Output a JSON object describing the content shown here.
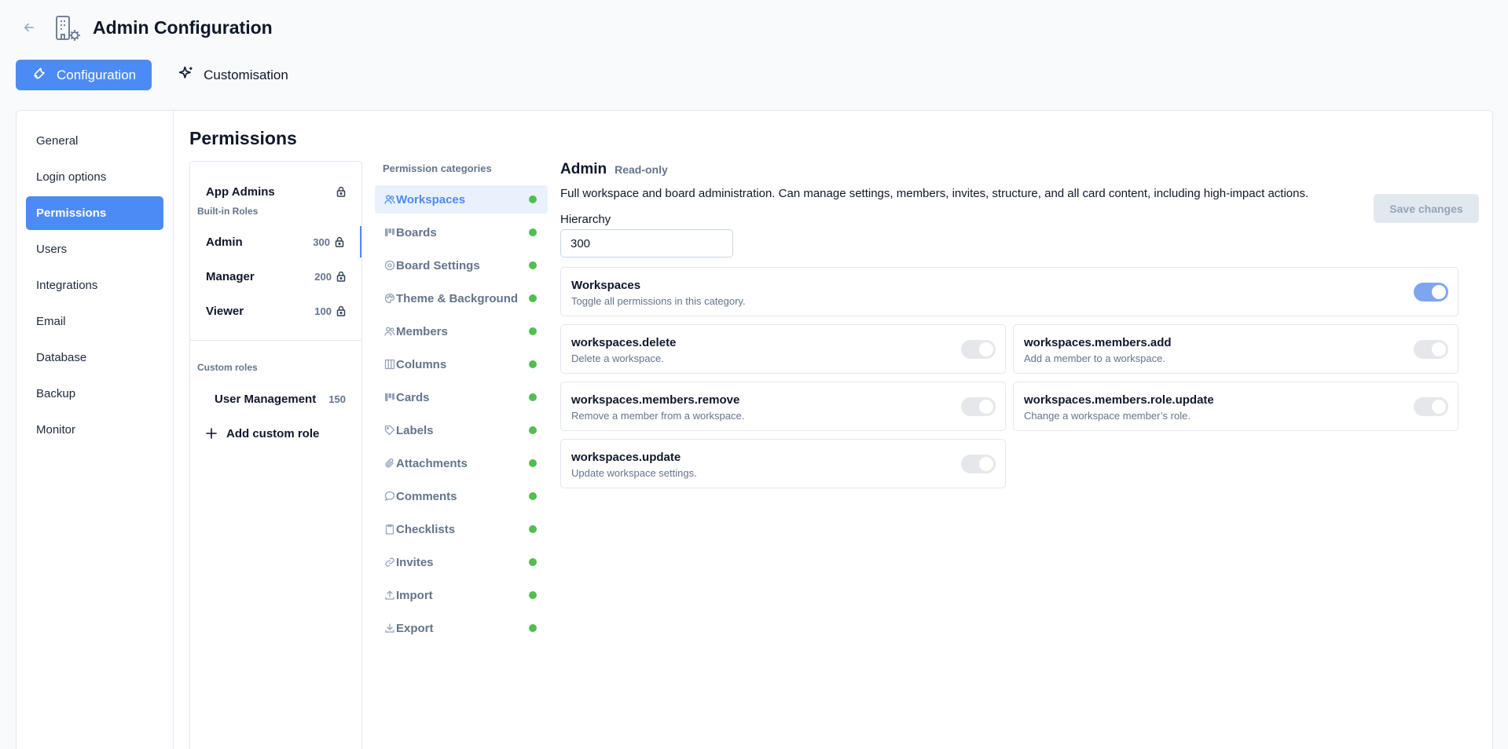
{
  "header": {
    "title": "Admin Configuration",
    "back_icon": "arrow-left-icon",
    "app_icon": "building-gear-icon"
  },
  "tabs": [
    {
      "label": "Configuration",
      "icon": "wrench-icon",
      "active": true
    },
    {
      "label": "Customisation",
      "icon": "sparkles-icon",
      "active": false
    }
  ],
  "sidebar": {
    "items": [
      {
        "label": "General"
      },
      {
        "label": "Login options"
      },
      {
        "label": "Permissions",
        "active": true
      },
      {
        "label": "Users"
      },
      {
        "label": "Integrations"
      },
      {
        "label": "Email"
      },
      {
        "label": "Database"
      },
      {
        "label": "Backup"
      },
      {
        "label": "Monitor"
      }
    ]
  },
  "permissions": {
    "title": "Permissions",
    "roles": {
      "app_admins": {
        "name": "App Admins"
      },
      "builtin_label": "Built-in Roles",
      "builtin": [
        {
          "name": "Admin",
          "hierarchy": "300"
        },
        {
          "name": "Manager",
          "hierarchy": "200"
        },
        {
          "name": "Viewer",
          "hierarchy": "100"
        }
      ],
      "custom_label": "Custom roles",
      "custom": [
        {
          "name": "User Management",
          "hierarchy": "150"
        }
      ],
      "add_custom": "Add custom role"
    },
    "categories_label": "Permission categories",
    "categories": [
      {
        "label": "Workspaces",
        "icon": "users-icon",
        "active": true
      },
      {
        "label": "Boards",
        "icon": "board-icon"
      },
      {
        "label": "Board Settings",
        "icon": "settings-icon"
      },
      {
        "label": "Theme & Background",
        "icon": "palette-icon"
      },
      {
        "label": "Members",
        "icon": "user-icon"
      },
      {
        "label": "Columns",
        "icon": "columns-icon"
      },
      {
        "label": "Cards",
        "icon": "cards-icon"
      },
      {
        "label": "Labels",
        "icon": "tag-icon"
      },
      {
        "label": "Attachments",
        "icon": "paperclip-icon"
      },
      {
        "label": "Comments",
        "icon": "comment-icon"
      },
      {
        "label": "Checklists",
        "icon": "checklist-icon"
      },
      {
        "label": "Invites",
        "icon": "link-icon"
      },
      {
        "label": "Import",
        "icon": "upload-icon"
      },
      {
        "label": "Export",
        "icon": "download-icon"
      }
    ],
    "detail": {
      "role_name": "Admin",
      "readonly": "Read-only",
      "description": "Full workspace and board administration. Can manage settings, members, invites, structure, and all card content, including high-impact actions.",
      "save_label": "Save changes",
      "hierarchy_label": "Hierarchy",
      "hierarchy_value": "300",
      "category": {
        "title": "Workspaces",
        "desc": "Toggle all permissions in this category.",
        "enabled": true
      },
      "perms": [
        {
          "title": "workspaces.delete",
          "desc": "Delete a workspace.",
          "enabled": true
        },
        {
          "title": "workspaces.members.add",
          "desc": "Add a member to a workspace.",
          "enabled": true
        },
        {
          "title": "workspaces.members.remove",
          "desc": "Remove a member from a workspace.",
          "enabled": true
        },
        {
          "title": "workspaces.members.role.update",
          "desc": "Change a workspace member’s role.",
          "enabled": true
        },
        {
          "title": "workspaces.update",
          "desc": "Update workspace settings.",
          "enabled": true
        }
      ]
    }
  },
  "colors": {
    "accent": "#4c8bf5",
    "status_dot": "#4fbf4f",
    "toggle_on": "#7ea6ef",
    "toggle_disabled": "#e5e7eb"
  }
}
